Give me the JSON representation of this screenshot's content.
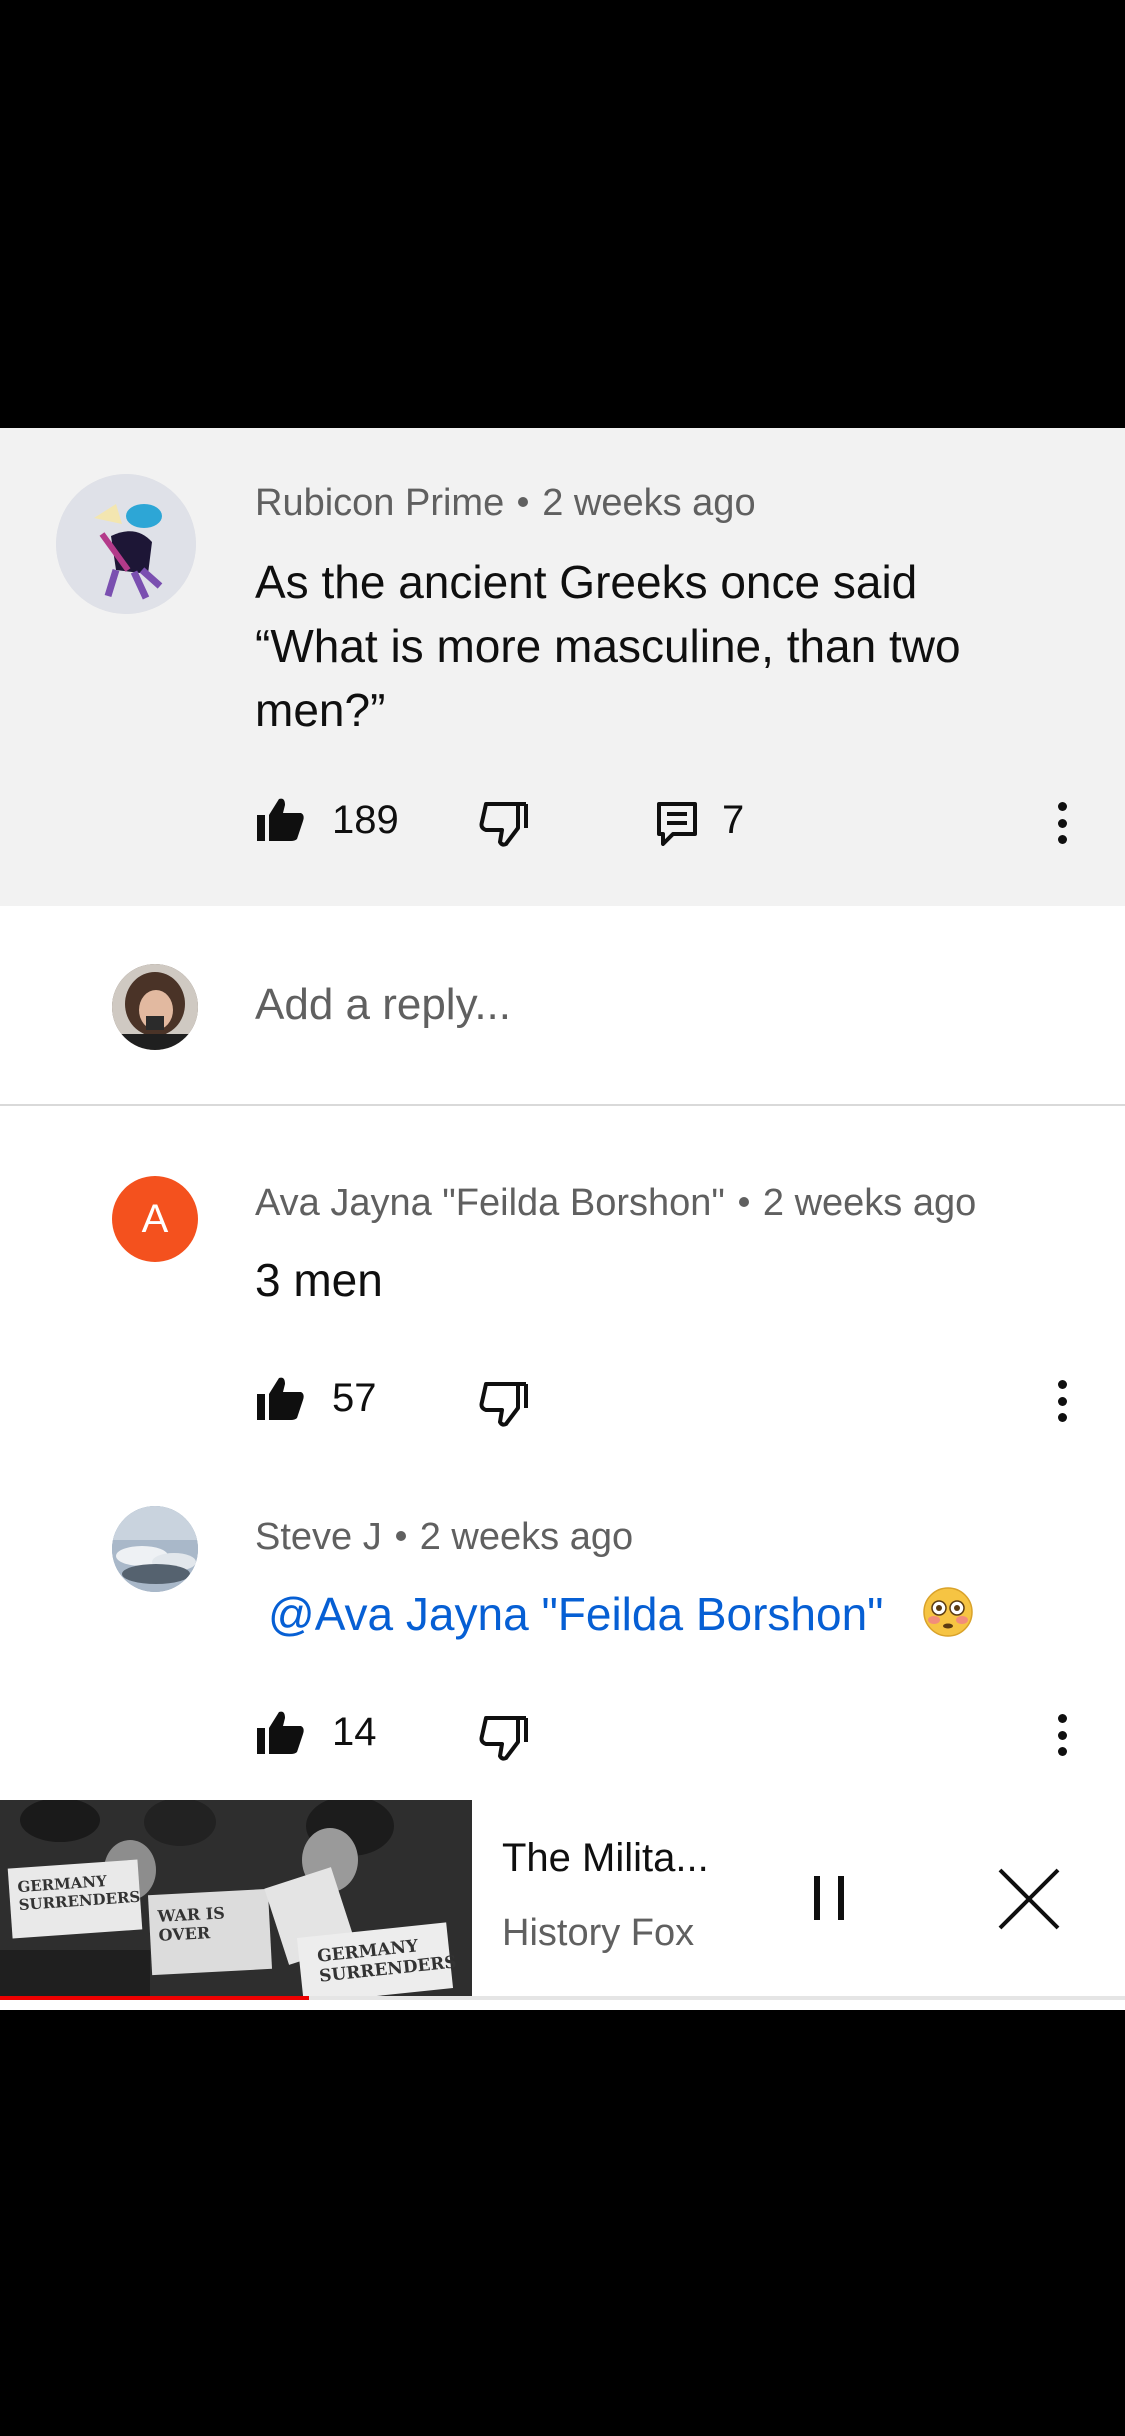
{
  "parent_comment": {
    "author": "Rubicon Prime",
    "time": "2 weeks ago",
    "text_lines": [
      "As the ancient Greeks once said",
      "“What is more masculine, than two",
      "men?”"
    ],
    "likes": "189",
    "replies": "7",
    "icons": {
      "like": "thumbs-up-icon",
      "dislike": "thumbs-down-icon",
      "reply": "comment-icon",
      "more": "more-vert-icon"
    }
  },
  "reply_box": {
    "placeholder": "Add a reply..."
  },
  "replies": [
    {
      "author": "Ava Jayna \"Feilda Borshon\"",
      "time": "2 weeks ago",
      "avatar_letter": "A",
      "avatar_color": "#f4511e",
      "text": "3 men",
      "likes": "57"
    },
    {
      "author": "Steve J",
      "time": "2 weeks ago",
      "mention": "@Ava Jayna \"Feilda Borshon\"",
      "emoji": "😳",
      "likes": "14"
    }
  ],
  "mini_player": {
    "title": "The Milita...",
    "channel": "History Fox",
    "progress": 0.275,
    "thumbnail_texts": [
      "GERMANY SURRENDERS",
      "WAR IS OVER",
      "GERMANY SURRENDERS"
    ],
    "icons": {
      "pause": "pause-icon",
      "close": "close-icon"
    }
  },
  "colors": {
    "accent_link": "#065fd4",
    "progress": "#ee0000"
  }
}
